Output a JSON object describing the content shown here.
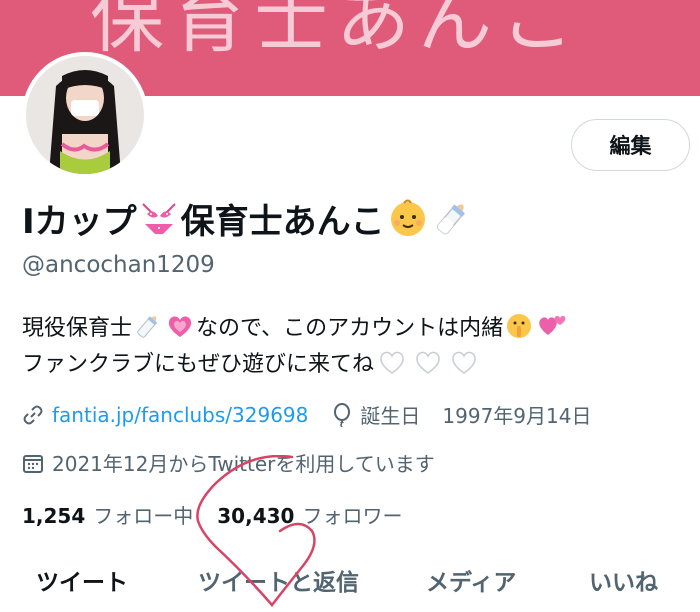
{
  "banner": {
    "text": "保育士あんこ"
  },
  "profile": {
    "edit_label": "編集",
    "name_part1": "Iカップ",
    "name_part2": "保育士あんこ",
    "handle": "@ancochan1209",
    "bio": {
      "line1_a": "現役保育士",
      "line1_b": "なので、このアカウントは内緒",
      "line2": "ファンクラブにもぜひ遊びに来てね"
    },
    "link": "fantia.jp/fanclubs/329698",
    "birthday_label": "誕生日",
    "birthday_value": "1997年9月14日",
    "joined": "2021年12月からTwitterを利用しています",
    "following_count": "1,254",
    "following_label": "フォロー中",
    "followers_count": "30,430",
    "followers_label": "フォロワー"
  },
  "tabs": [
    {
      "label": "ツイート"
    },
    {
      "label": "ツイートと返信"
    },
    {
      "label": "メディア"
    },
    {
      "label": "いいね"
    }
  ],
  "colors": {
    "banner": "#e05a79",
    "link": "#1d9bf0",
    "secondary_text": "#536471",
    "scribble": "#d64565"
  }
}
